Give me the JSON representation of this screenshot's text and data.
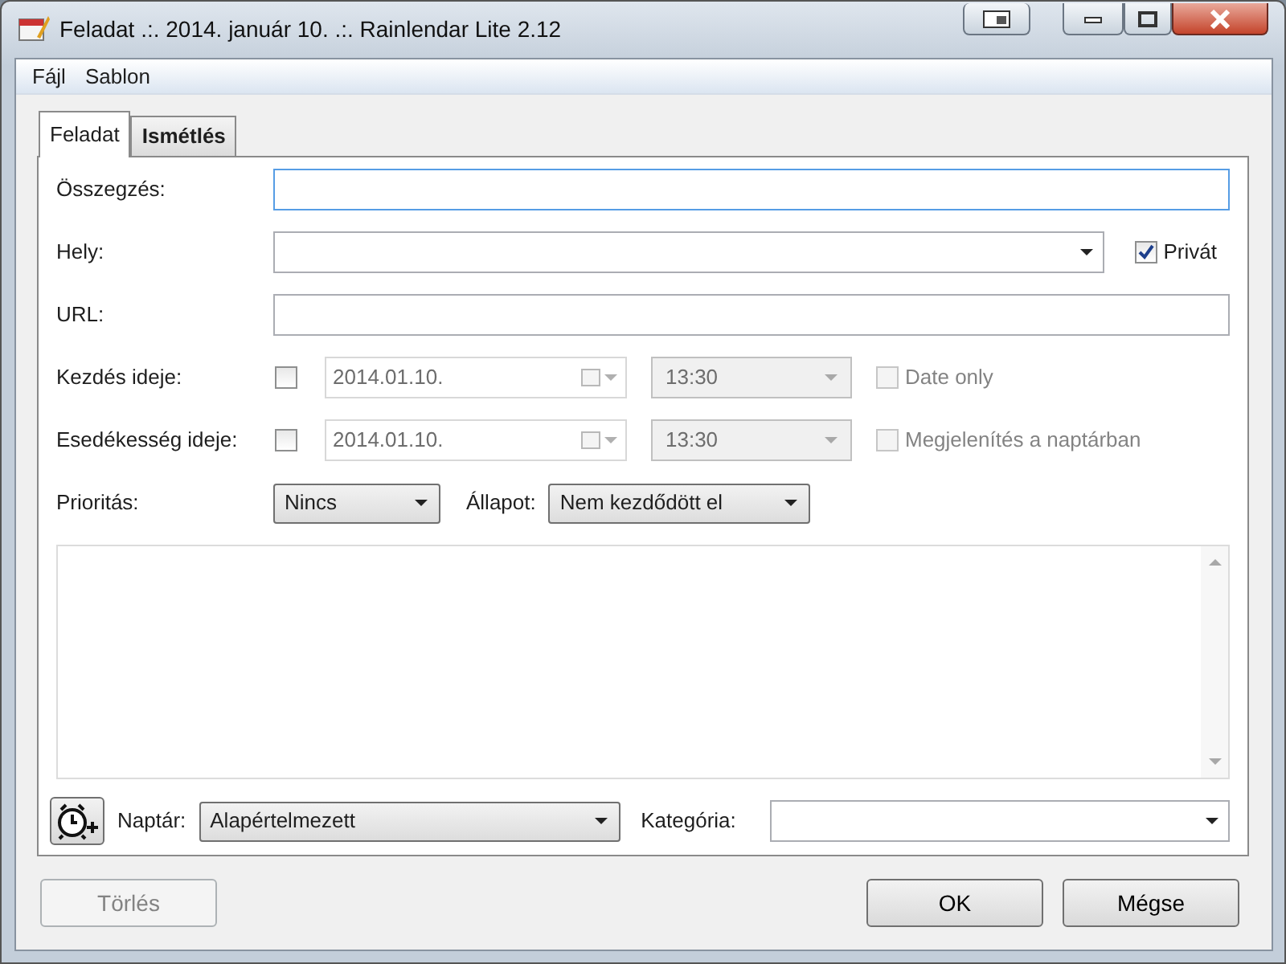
{
  "window": {
    "title": "Feladat .:. 2014. január 10. .:. Rainlendar Lite 2.12"
  },
  "menu": [
    {
      "label": "Fájl"
    },
    {
      "label": "Sablon"
    }
  ],
  "tabs": [
    {
      "label": "Feladat",
      "selected": true
    },
    {
      "label": "Ismétlés",
      "selected": false
    }
  ],
  "summary": {
    "label": "Összegzés:"
  },
  "location": {
    "label": "Hely:",
    "private": {
      "label": "Privát",
      "checked": true
    }
  },
  "url": {
    "label": "URL:"
  },
  "times": [
    {
      "label": "Kezdés ideje:",
      "checked": false,
      "date": "2014.01.10.",
      "time": "13:30",
      "option": {
        "label": "Date only",
        "checked": false,
        "disabled": true
      }
    },
    {
      "label": "Esedékesség ideje:",
      "checked": false,
      "date": "2014.01.10.",
      "time": "13:30",
      "option": {
        "label": "Megjelenítés a naptárban",
        "checked": false,
        "disabled": true
      }
    }
  ],
  "priority": {
    "label": "Prioritás:",
    "value": "Nincs"
  },
  "status": {
    "label": "Állapot:",
    "value": "Nem kezdődött el"
  },
  "calendar": {
    "label": "Naptár:",
    "value": "Alapértelmezett"
  },
  "category": {
    "label": "Kategória:"
  },
  "buttons": [
    {
      "label": "Törlés",
      "disabled": true
    },
    {
      "label": "OK",
      "disabled": false
    },
    {
      "label": "Mégse",
      "disabled": false
    }
  ]
}
